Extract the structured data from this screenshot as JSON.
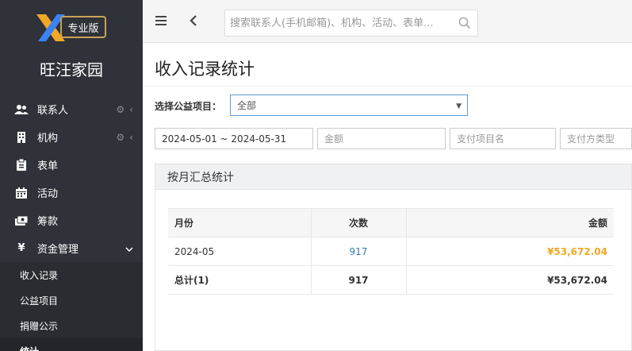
{
  "app": {
    "badge": "专业版",
    "name": "旺汪家园"
  },
  "colors": {
    "sidebar_bg": "#2f3238",
    "accent_gold": "#f0a826",
    "link_blue": "#337ab7",
    "logo_gold": "#c9a35a"
  },
  "sidebar": {
    "items": [
      {
        "label": "联系人",
        "icon": "users-icon",
        "has_gear": true,
        "chevron": "left"
      },
      {
        "label": "机构",
        "icon": "building-icon",
        "has_gear": true,
        "chevron": "left"
      },
      {
        "label": "表单",
        "icon": "clipboard-icon",
        "has_gear": false
      },
      {
        "label": "活动",
        "icon": "calendar-icon",
        "has_gear": false
      },
      {
        "label": "筹款",
        "icon": "money-icon",
        "has_gear": false
      },
      {
        "label": "资金管理",
        "icon": "yen-icon",
        "has_gear": false,
        "chevron": "down",
        "icon_glyph": "¥"
      }
    ],
    "subitems": [
      {
        "label": "收入记录"
      },
      {
        "label": "公益项目"
      },
      {
        "label": "捐赠公示"
      },
      {
        "label": "统计",
        "active": true
      }
    ]
  },
  "topbar": {
    "search_placeholder": "搜索联系人(手机邮箱)、机构、活动、表单..."
  },
  "page": {
    "title": "收入记录统计",
    "project_label": "选择公益项目：",
    "project_value": "全部",
    "filters": {
      "date_range": "2024-05-01 ~ 2024-05-31",
      "amount_placeholder": "金额",
      "project_name_placeholder": "支付项目名",
      "pay_type_placeholder": "支付方类型"
    },
    "panel_title": "按月汇总统计",
    "table": {
      "headers": [
        "月份",
        "次数",
        "金额"
      ],
      "rows": [
        {
          "month": "2024-05",
          "count": "917",
          "amount": "¥53,672.04"
        }
      ],
      "total": {
        "label": "总计(1)",
        "count": "917",
        "amount": "¥53,672.04"
      }
    }
  }
}
